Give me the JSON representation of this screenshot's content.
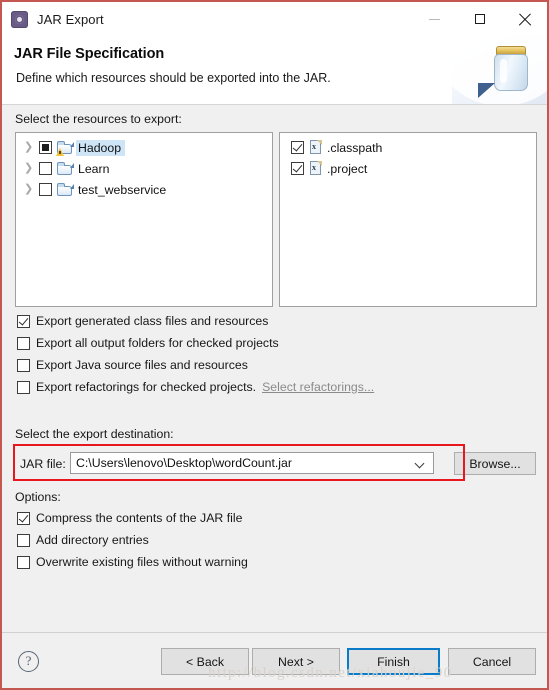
{
  "window": {
    "title": "JAR Export",
    "icon": "jar-export-gear-icon",
    "controls": {
      "minimize": "—",
      "maximize": "□",
      "close": "✕"
    },
    "border_color": "#c4574f"
  },
  "banner": {
    "title": "JAR File Specification",
    "subtitle": "Define which resources should be exported into the JAR.",
    "art": "jar-illustration"
  },
  "resources": {
    "label": "Select the resources to export:",
    "tree_items": [
      {
        "label": "Hadoop",
        "check_state": "grayed",
        "expandable": true,
        "selected": true,
        "warning": true
      },
      {
        "label": "Learn",
        "check_state": "unchecked",
        "expandable": true,
        "selected": false,
        "warning": false
      },
      {
        "label": "test_webservice",
        "check_state": "unchecked",
        "expandable": true,
        "selected": false,
        "warning": false
      }
    ],
    "file_items": [
      {
        "label": ".classpath",
        "check_state": "checked",
        "icon_text": "x"
      },
      {
        "label": ".project",
        "check_state": "checked",
        "icon_text": "x"
      }
    ]
  },
  "export_options": [
    {
      "label": "Export generated class files and resources",
      "checked": true
    },
    {
      "label": "Export all output folders for checked projects",
      "checked": false
    },
    {
      "label": "Export Java source files and resources",
      "checked": false
    },
    {
      "label": "Export refactorings for checked projects.",
      "checked": false,
      "link": "Select refactorings..."
    }
  ],
  "destination": {
    "label": "Select the export destination:",
    "field_label": "JAR file:",
    "value": "C:\\Users\\lenovo\\Desktop\\wordCount.jar",
    "placeholder": "",
    "browse_label": "Browse...",
    "highlight_color": "#e8171d"
  },
  "options": {
    "label": "Options:",
    "items": [
      {
        "label": "Compress the contents of the JAR file",
        "checked": true
      },
      {
        "label": "Add directory entries",
        "checked": false
      },
      {
        "label": "Overwrite existing files without warning",
        "checked": false
      }
    ]
  },
  "buttons": {
    "help": "?",
    "back": "< Back",
    "next": "Next >",
    "finish": "Finish",
    "cancel": "Cancel",
    "default_focus_color": "#0a7bc8"
  },
  "watermark": "http://blog.csdn.net/xiahoujie_90"
}
